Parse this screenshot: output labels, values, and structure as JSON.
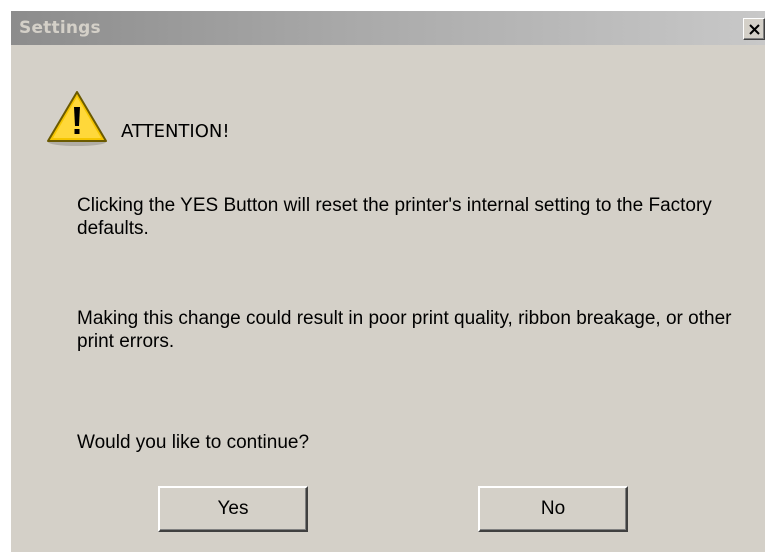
{
  "window": {
    "title": "Settings",
    "close_label": "X"
  },
  "dialog": {
    "icon": "warning-triangle-icon",
    "heading": "ATTENTION!",
    "message_1": "Clicking the YES Button will reset the printer's internal setting to the Factory defaults.",
    "message_2": "Making this change could result in poor print quality, ribbon breakage, or other print errors.",
    "message_3": "Would you like to continue?"
  },
  "buttons": {
    "yes_label": "Yes",
    "no_label": "No"
  },
  "colors": {
    "dialog_bg": "#d4d0c8",
    "titlebar_start": "#8c8c8c",
    "titlebar_end": "#c8c8c8",
    "warning_yellow": "#f5c500"
  }
}
